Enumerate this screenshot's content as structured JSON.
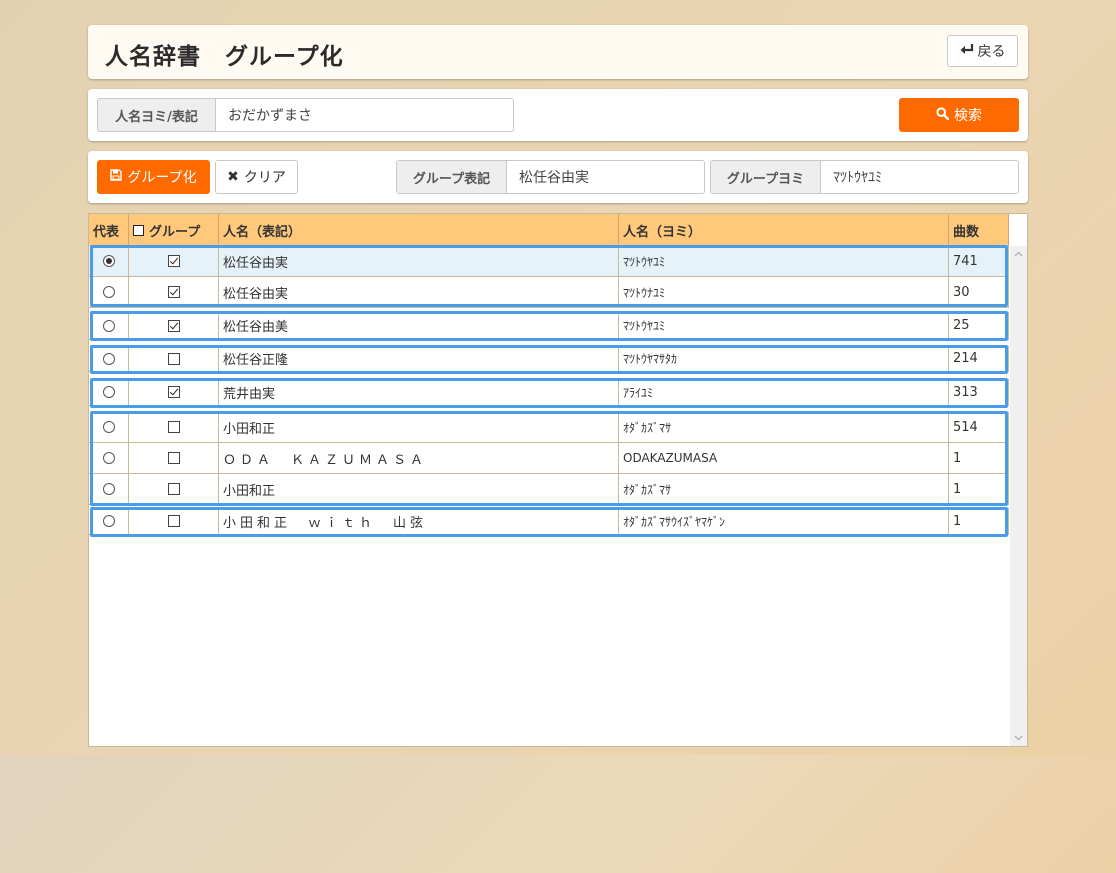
{
  "header": {
    "title": "人名辞書　グループ化",
    "back_label": "戻る"
  },
  "search": {
    "label": "人名ヨミ/表記",
    "value": "おだかずまさ",
    "button_label": "検索"
  },
  "toolbar": {
    "group_button_label": "グループ化",
    "clear_button_label": "クリア",
    "group_notation_label": "グループ表記",
    "group_notation_value": "松任谷由実",
    "group_reading_label": "グループヨミ",
    "group_reading_value": "ﾏﾂﾄｳﾔﾕﾐ"
  },
  "table": {
    "columns": [
      "代表",
      "グループ",
      "人名（表記）",
      "人名（ヨミ）",
      "曲数"
    ],
    "rows": [
      {
        "representative": true,
        "grouped": true,
        "name": "松任谷由実",
        "reading": "ﾏﾂﾄｳﾔﾕﾐ",
        "count": "741"
      },
      {
        "representative": false,
        "grouped": true,
        "name": "松任谷由実",
        "reading": "ﾏﾂﾄｳﾅﾕﾐ",
        "count": "30"
      },
      {
        "representative": false,
        "grouped": true,
        "name": "松任谷由美",
        "reading": "ﾏﾂﾄｳﾔﾕﾐ",
        "count": "25"
      },
      {
        "representative": false,
        "grouped": false,
        "name": "松任谷正隆",
        "reading": "ﾏﾂﾄｳﾔﾏｻﾀｶ",
        "count": "214"
      },
      {
        "representative": false,
        "grouped": true,
        "name": "荒井由実",
        "reading": "ｱﾗｲﾕﾐ",
        "count": "313"
      },
      {
        "representative": false,
        "grouped": false,
        "name": "小田和正",
        "reading": "ｵﾀﾞｶｽﾞﾏｻ",
        "count": "514"
      },
      {
        "representative": false,
        "grouped": false,
        "name": "ＯＤＡ　ＫＡＺＵＭＡＳＡ",
        "reading": "ODAKAZUMASA",
        "count": "1"
      },
      {
        "representative": false,
        "grouped": false,
        "name": "小田和正",
        "reading": "ｵﾀﾞｶｽﾞﾏｻ",
        "count": "1"
      },
      {
        "representative": false,
        "grouped": false,
        "name": "小田和正　ｗｉｔｈ　山弦",
        "reading": "ｵﾀﾞｶｽﾞﾏｻｳｲｽﾞﾔﾏｹﾞﾝ",
        "count": "1"
      }
    ]
  },
  "colors": {
    "accent": "#ff6a00",
    "header_bg": "#ffc87a",
    "group_border": "#4a9be8",
    "selected_row": "#e6f2fa"
  }
}
